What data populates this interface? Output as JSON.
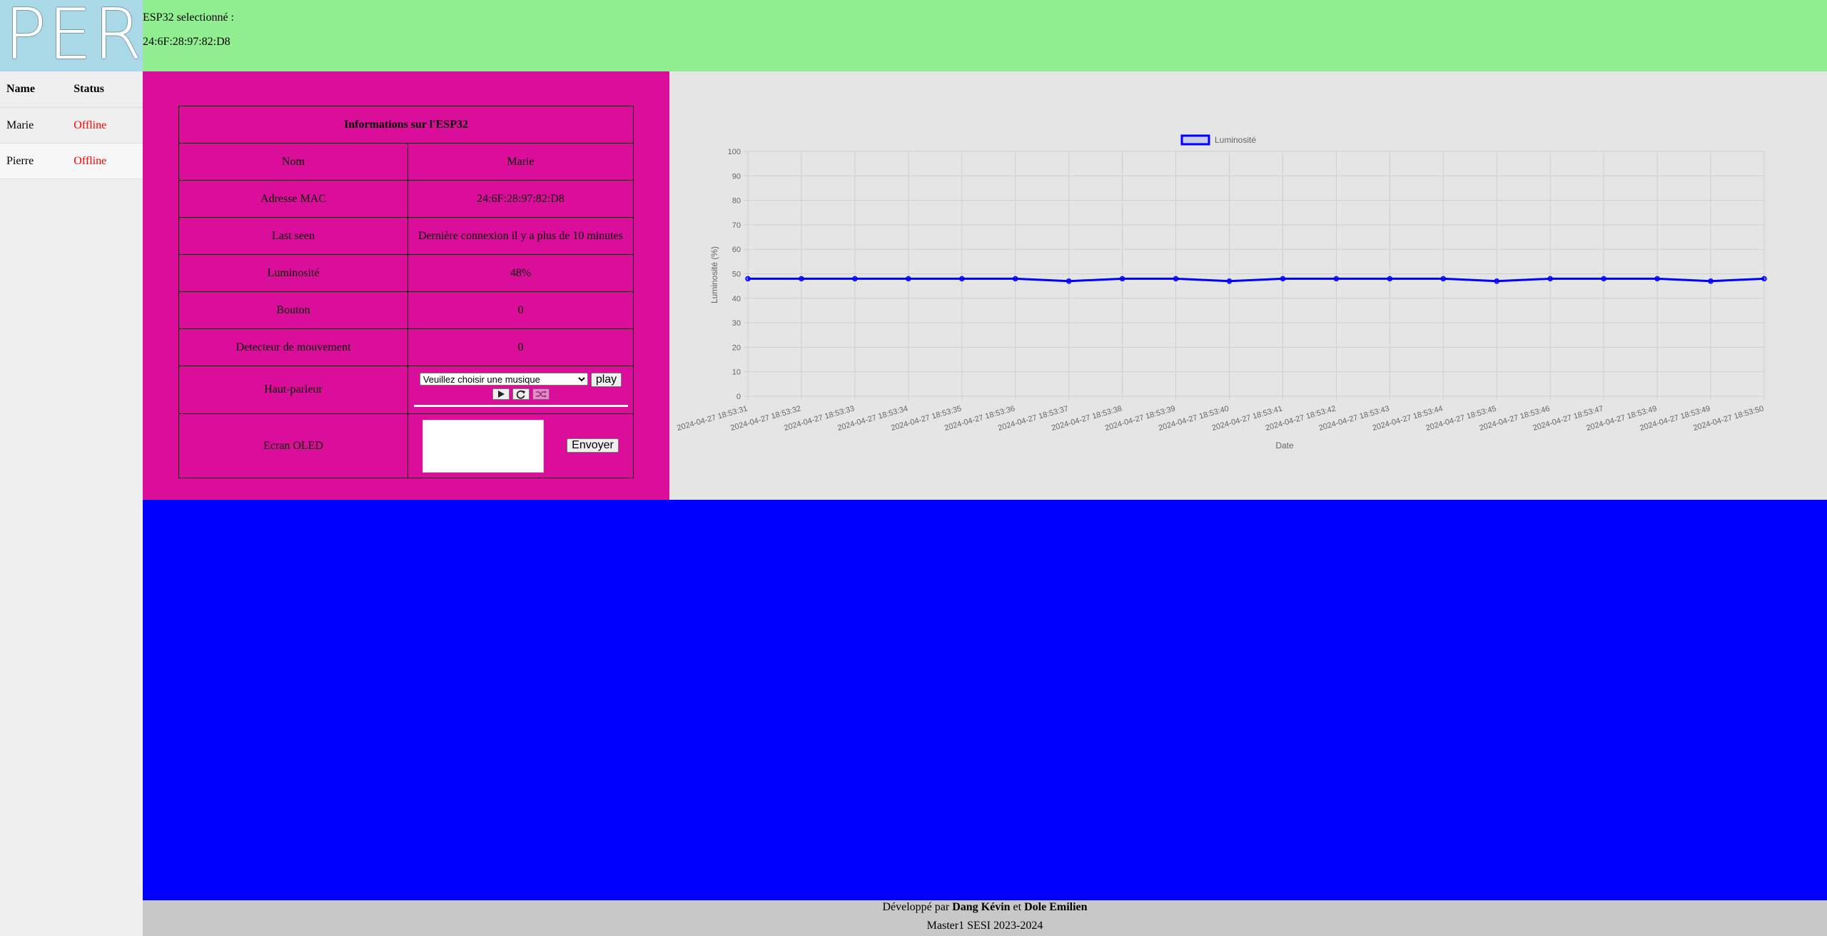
{
  "logo": {
    "text": "PERI"
  },
  "header": {
    "selected_label": "ESP32 selectionné :",
    "selected_mac": "24:6F:28:97:82:D8"
  },
  "sidebar": {
    "col_name": "Name",
    "col_status": "Status",
    "devices": [
      {
        "name": "Marie",
        "status": "Offline"
      },
      {
        "name": "Pierre",
        "status": "Offline"
      }
    ]
  },
  "info": {
    "title": "Informations sur l'ESP32",
    "rows": [
      {
        "label": "Nom",
        "value": "Marie"
      },
      {
        "label": "Adresse MAC",
        "value": "24:6F:28:97:82:D8"
      },
      {
        "label": "Last seen",
        "value": "Dernière connexion il y a plus de 10 minutes"
      },
      {
        "label": "Luminosité",
        "value": "48%"
      },
      {
        "label": "Bouton",
        "value": "0"
      },
      {
        "label": "Detecteur de mouvement",
        "value": "0"
      }
    ],
    "speaker_label": "Haut-parleur",
    "music_placeholder": "Veuillez choisir une musique",
    "play_label": "play",
    "oled_label": "Ecran OLED",
    "send_label": "Envoyer"
  },
  "colors": {
    "header": "#90ee90",
    "info_panel": "#db0d9b",
    "chart_panel": "#e5e5e5",
    "blue_panel": "#0000ff",
    "line": "#0000ff",
    "offline": "#ff0000"
  },
  "chart_data": {
    "type": "line",
    "legend": "Luminosité",
    "legend_position": "top",
    "xlabel": "Date",
    "ylabel": "Luminosité (%)",
    "ylim": [
      0,
      100
    ],
    "yticks": [
      0,
      10,
      20,
      30,
      40,
      50,
      60,
      70,
      80,
      90,
      100
    ],
    "grid": true,
    "x": [
      "2024-04-27 18:53:31",
      "2024-04-27 18:53:32",
      "2024-04-27 18:53:33",
      "2024-04-27 18:53:34",
      "2024-04-27 18:53:35",
      "2024-04-27 18:53:36",
      "2024-04-27 18:53:37",
      "2024-04-27 18:53:38",
      "2024-04-27 18:53:39",
      "2024-04-27 18:53:40",
      "2024-04-27 18:53:41",
      "2024-04-27 18:53:42",
      "2024-04-27 18:53:43",
      "2024-04-27 18:53:44",
      "2024-04-27 18:53:45",
      "2024-04-27 18:53:46",
      "2024-04-27 18:53:47",
      "2024-04-27 18:53:49",
      "2024-04-27 18:53:49",
      "2024-04-27 18:53:50"
    ],
    "values": [
      48,
      48,
      48,
      48,
      48,
      48,
      47,
      48,
      48,
      47,
      48,
      48,
      48,
      48,
      47,
      48,
      48,
      48,
      47,
      48
    ]
  },
  "footer": {
    "dev_prefix": "Développé par",
    "author1": "Dang Kévin",
    "joiner": "et",
    "author2": "Dole Emilien",
    "line2": "Master1 SESI 2023-2024"
  }
}
